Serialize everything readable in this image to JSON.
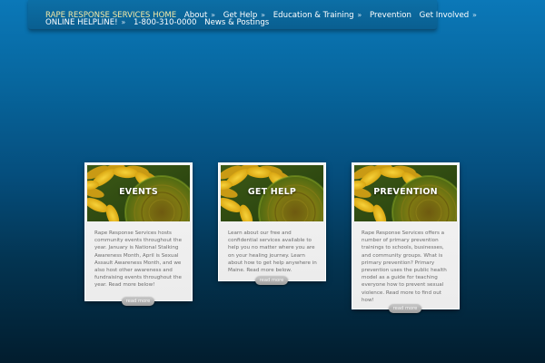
{
  "nav": {
    "items": [
      {
        "label": "RAPE RESPONSE SERVICES HOME",
        "has_arrow": false
      },
      {
        "label": "About",
        "has_arrow": true
      },
      {
        "label": "Get Help",
        "has_arrow": true
      },
      {
        "label": "Education & Training",
        "has_arrow": true
      },
      {
        "label": "Prevention",
        "has_arrow": false
      },
      {
        "label": "Get Involved",
        "has_arrow": true
      },
      {
        "label": "ONLINE HELPLINE!",
        "has_arrow": true
      },
      {
        "label": "1-800-310-0000",
        "has_arrow": false
      },
      {
        "label": "News & Postings",
        "has_arrow": false
      }
    ],
    "arrow_glyph": "»"
  },
  "cards": [
    {
      "title": "EVENTS",
      "text": "Rape Response Services hosts community events throughout the year. January is National Stalking Awareness Month, April is Sexual Assault Awareness Month, and we also host other awareness and fundraising events throughout the year. Read more below!",
      "button": "read more"
    },
    {
      "title": "GET HELP",
      "text": "Learn about our free and confidential services available to help you no matter where you are on your healing journey. Learn about how to get help anywhere in Maine. Read more below.",
      "button": "read more"
    },
    {
      "title": "PREVENTION",
      "text": "Rape Response Services offers a number of primary prevention trainings to schools, businesses, and community groups. What is primary prevention? Primary prevention uses the public health model as a guide for teaching everyone how to prevent sexual violence. Read more to find out how!",
      "button": "read more"
    }
  ],
  "colors": {
    "nav_home": "#f2e9a6",
    "page_top": "#0b78b8",
    "page_bottom": "#021d2e"
  },
  "icons": {
    "card_image": "sunflower-image"
  }
}
